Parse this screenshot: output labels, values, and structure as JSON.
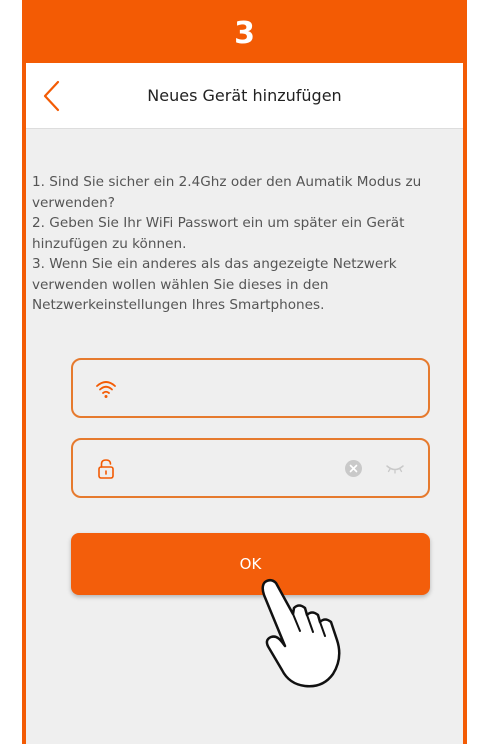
{
  "step": {
    "number": "3"
  },
  "header": {
    "title": "Neues Gerät hinzufügen",
    "back_icon": "chevron-left-icon"
  },
  "instructions": {
    "line1": "1. Sind Sie sicher ein 2.4Ghz oder den Aumatik Modus zu verwenden?",
    "line2": "2. Geben Sie Ihr WiFi Passwort ein um später ein Gerät hinzufügen zu können.",
    "line3": "3. Wenn Sie ein anderes als das angezeigte Netzwerk verwenden wollen wählen Sie dieses in den Netzwerkeinstellungen Ihres Smartphones."
  },
  "wifi_field": {
    "value": "",
    "icon": "wifi-icon"
  },
  "password_field": {
    "value": "",
    "icon": "lock-icon",
    "clear_icon": "clear-icon",
    "toggle_icon": "eye-closed-icon"
  },
  "ok_button": {
    "label": "OK"
  },
  "overlay": {
    "icon": "hand-pointer-icon"
  },
  "colors": {
    "accent": "#f35b04",
    "field_border": "#e67a2e",
    "background": "#efefef"
  }
}
